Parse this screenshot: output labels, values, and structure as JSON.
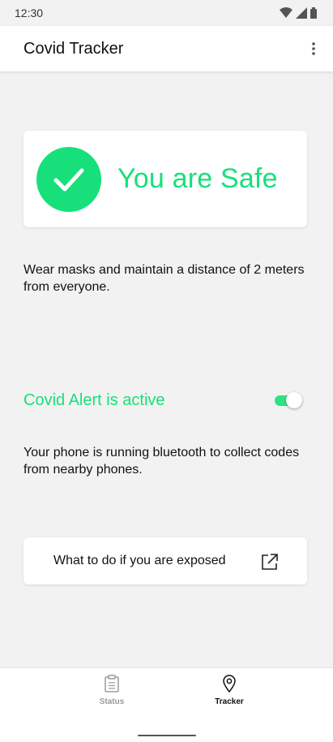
{
  "status_bar": {
    "time": "12:30"
  },
  "app_bar": {
    "title": "Covid Tracker"
  },
  "safe_card": {
    "text": "You are Safe"
  },
  "advice": {
    "text": "Wear masks and maintain a distance of 2 meters from everyone."
  },
  "alert": {
    "label": "Covid Alert is active",
    "toggle_on": true
  },
  "bluetooth_note": {
    "text": "Your phone is running bluetooth to collect codes from nearby phones."
  },
  "exposed_card": {
    "label": "What to do if you are exposed"
  },
  "bottom_nav": {
    "items": [
      {
        "label": "Status",
        "icon": "clipboard-icon",
        "active": false
      },
      {
        "label": "Tracker",
        "icon": "location-pin-icon",
        "active": true
      }
    ]
  },
  "colors": {
    "accent": "#17e07a",
    "background": "#f2f2f2",
    "inactive": "#9a9a9a"
  }
}
